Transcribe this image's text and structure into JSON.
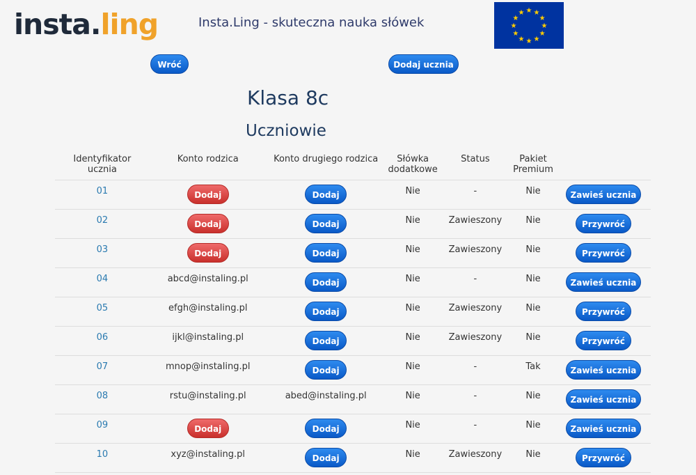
{
  "header": {
    "logo_part1": "insta",
    "logo_dot": ".",
    "logo_part2": "ling",
    "tagline": "Insta.Ling - skuteczna nauka słówek",
    "flag_icon": "eu-flag-icon",
    "colors": {
      "logo_dark": "#1f2a3a",
      "logo_accent": "#f0a22a",
      "flag_blue": "#0033a0",
      "flag_star": "#ffcc00"
    }
  },
  "toolbar": {
    "back_label": "Wróć",
    "add_student_label": "Dodaj ucznia"
  },
  "page": {
    "class_title": "Klasa 8c",
    "section_title": "Uczniowie"
  },
  "table": {
    "headers": {
      "student_id": "Identyfikator ucznia",
      "parent_account": "Konto rodzica",
      "second_parent_account": "Konto drugiego rodzica",
      "extra_words": "Słówka dodatkowe",
      "status": "Status",
      "premium": "Pakiet Premium"
    },
    "add_label": "Dodaj",
    "rows": [
      {
        "id": "01",
        "parent": "Dodaj",
        "second_parent": "Dodaj",
        "extra": "Nie",
        "status": "-",
        "premium": "Nie",
        "action": "Zawieś ucznia"
      },
      {
        "id": "02",
        "parent": "Dodaj",
        "second_parent": "Dodaj",
        "extra": "Nie",
        "status": "Zawieszony",
        "premium": "Nie",
        "action": "Przywróć"
      },
      {
        "id": "03",
        "parent": "Dodaj",
        "second_parent": "Dodaj",
        "extra": "Nie",
        "status": "Zawieszony",
        "premium": "Nie",
        "action": "Przywróć"
      },
      {
        "id": "04",
        "parent": "abcd@instaling.pl",
        "second_parent": "Dodaj",
        "extra": "Nie",
        "status": "-",
        "premium": "Nie",
        "action": "Zawieś ucznia"
      },
      {
        "id": "05",
        "parent": "efgh@instaling.pl",
        "second_parent": "Dodaj",
        "extra": "Nie",
        "status": "Zawieszony",
        "premium": "Nie",
        "action": "Przywróć"
      },
      {
        "id": "06",
        "parent": "ijkl@instaling.pl",
        "second_parent": "Dodaj",
        "extra": "Nie",
        "status": "Zawieszony",
        "premium": "Nie",
        "action": "Przywróć"
      },
      {
        "id": "07",
        "parent": "mnop@instaling.pl",
        "second_parent": "Dodaj",
        "extra": "Nie",
        "status": "-",
        "premium": "Tak",
        "action": "Zawieś ucznia"
      },
      {
        "id": "08",
        "parent": "rstu@instaling.pl",
        "second_parent": "abed@instaling.pl",
        "extra": "Nie",
        "status": "-",
        "premium": "Nie",
        "action": "Zawieś ucznia"
      },
      {
        "id": "09",
        "parent": "Dodaj",
        "second_parent": "Dodaj",
        "extra": "Nie",
        "status": "-",
        "premium": "Nie",
        "action": "Zawieś ucznia"
      },
      {
        "id": "10",
        "parent": "xyz@instaling.pl",
        "second_parent": "Dodaj",
        "extra": "Nie",
        "status": "Zawieszony",
        "premium": "Nie",
        "action": "Przywróć"
      }
    ]
  }
}
